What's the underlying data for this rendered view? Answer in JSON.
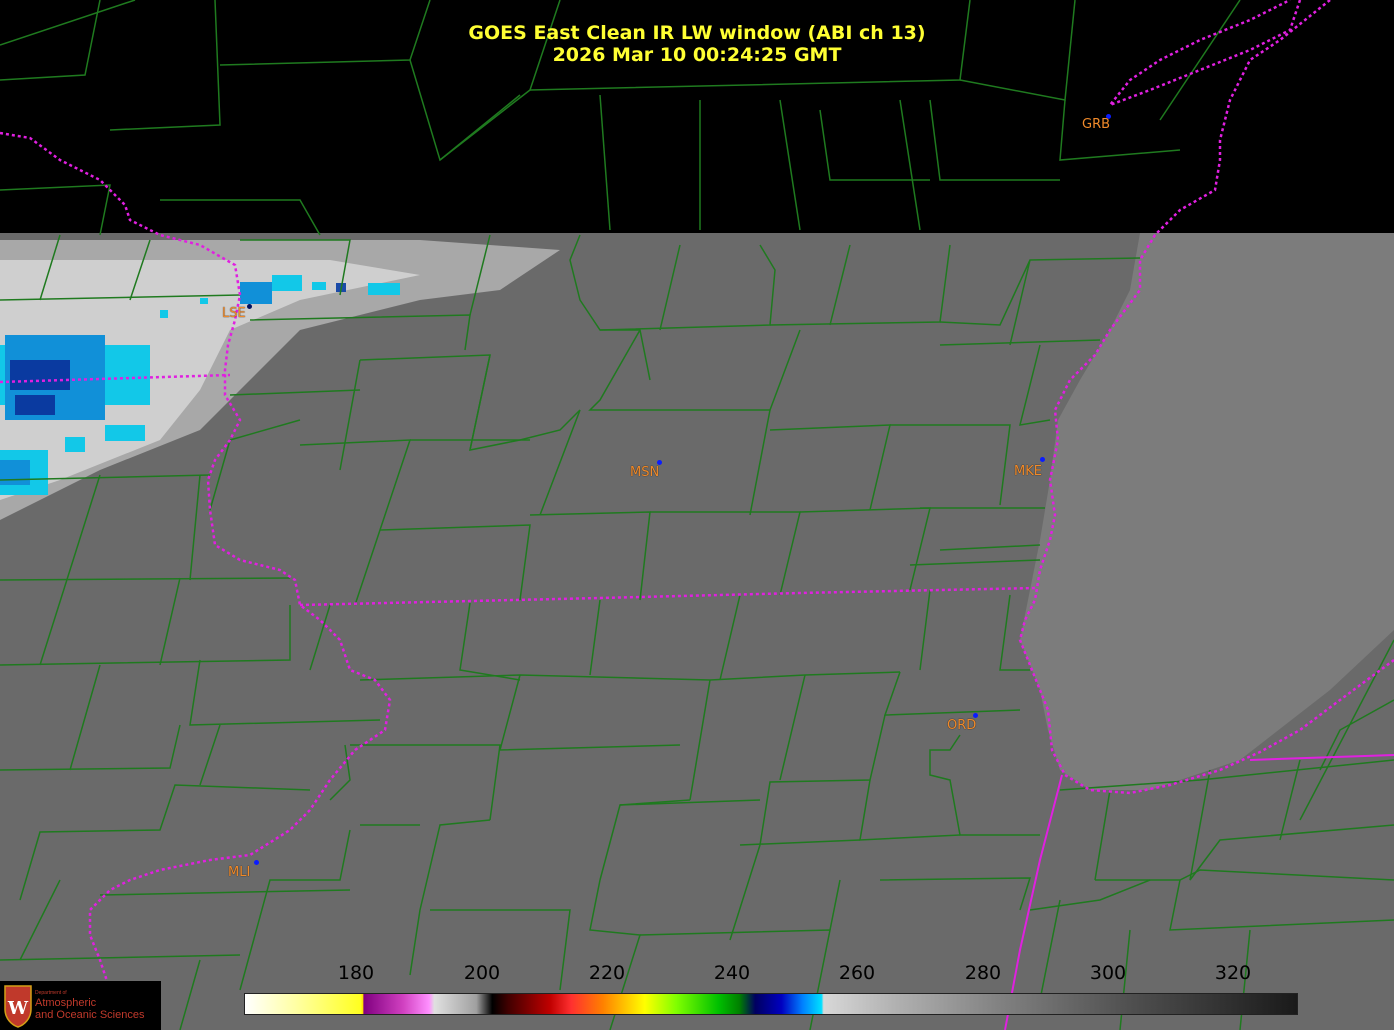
{
  "header": {
    "line1": "GOES East Clean IR LW window (ABI ch 13)",
    "line2": "2026 Mar 10  00:24:25 GMT"
  },
  "cities": [
    {
      "code": "GRB"
    },
    {
      "code": "LSE"
    },
    {
      "code": "MSN"
    },
    {
      "code": "MKE"
    },
    {
      "code": "ORD"
    },
    {
      "code": "MLI"
    }
  ],
  "colorbar": {
    "unit_ticks": [
      "180",
      "200",
      "220",
      "240",
      "260",
      "280",
      "300",
      "320"
    ]
  },
  "logo": {
    "small": "Department of",
    "line1": "Atmospheric",
    "line2": "and Oceanic Sciences"
  },
  "colors": {
    "title": "#ffff33",
    "city_label": "#f08a2a",
    "county_lines": "#1f7a1f",
    "state_lines": "#e020e0",
    "city_marker": "#0a1cff"
  }
}
